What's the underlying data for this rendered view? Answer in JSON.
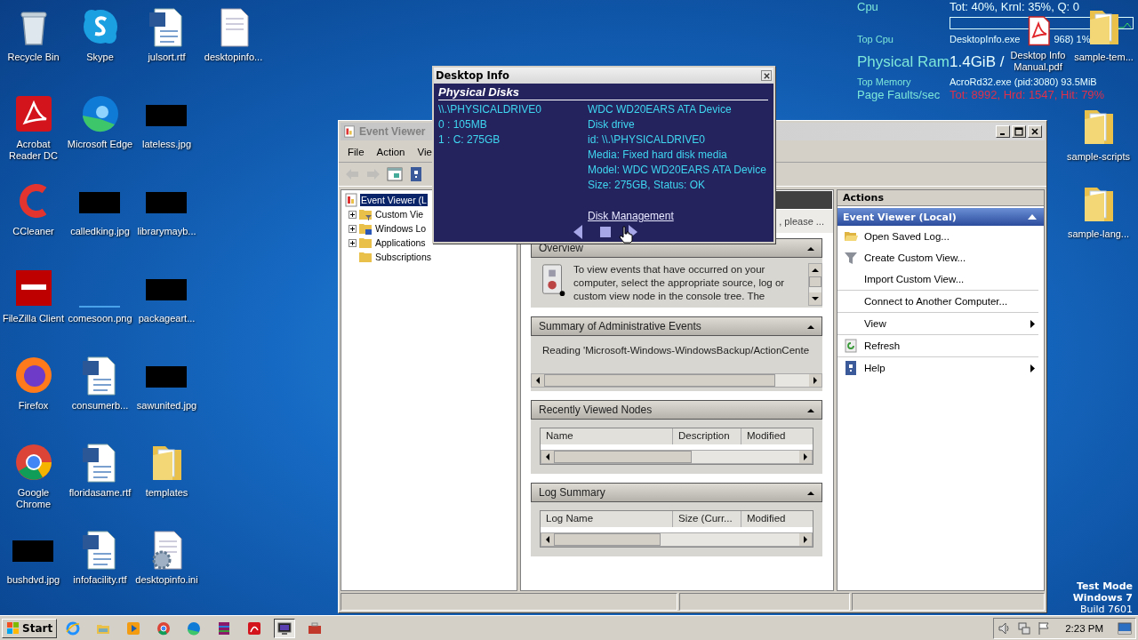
{
  "desktop_icons": [
    [
      {
        "label": "Recycle Bin",
        "kind": "recycle-bin"
      },
      {
        "label": "Skype",
        "kind": "skype"
      },
      {
        "label": "julsort.rtf",
        "kind": "document"
      },
      {
        "label": "desktopinfo...",
        "kind": "file"
      }
    ],
    [
      {
        "label": "Acrobat Reader DC",
        "kind": "acrobat"
      },
      {
        "label": "Microsoft Edge",
        "kind": "edge"
      },
      {
        "label": "lateless.jpg",
        "kind": "thumbnail"
      }
    ],
    [
      {
        "label": "CCleaner",
        "kind": "ccleaner"
      },
      {
        "label": "calledking.jpg",
        "kind": "thumbnail"
      },
      {
        "label": "librarymayb...",
        "kind": "thumbnail"
      }
    ],
    [
      {
        "label": "FileZilla Client",
        "kind": "filezilla"
      },
      {
        "label": "comesoon.png",
        "kind": "blank-image"
      },
      {
        "label": "packageart...",
        "kind": "thumbnail"
      }
    ],
    [
      {
        "label": "Firefox",
        "kind": "firefox"
      },
      {
        "label": "consumerb...",
        "kind": "document"
      },
      {
        "label": "sawunited.jpg",
        "kind": "thumbnail"
      }
    ],
    [
      {
        "label": "Google Chrome",
        "kind": "chrome"
      },
      {
        "label": "floridasame.rtf",
        "kind": "document"
      },
      {
        "label": "templates",
        "kind": "folder"
      }
    ],
    [
      {
        "label": "bushdvd.jpg",
        "kind": "thumbnail"
      },
      {
        "label": "infofacility.rtf",
        "kind": "document"
      },
      {
        "label": "desktopinfo.ini",
        "kind": "settings-file"
      }
    ]
  ],
  "desktop_icons_right": [
    {
      "label": "Desktop Info Manual.pdf",
      "kind": "pdf"
    },
    {
      "label": "sample-tem...",
      "kind": "folder"
    },
    {
      "label": "sample-scripts",
      "kind": "folder"
    },
    {
      "label": "sample-lang...",
      "kind": "folder"
    }
  ],
  "system_info": [
    {
      "label": "Cpu",
      "value": [
        "Tot: 40%, Krnl: 35%, Q: 0"
      ],
      "kind": "medium",
      "alert": false
    },
    {
      "label": "Top Cpu",
      "value": [
        "DesktopInfo.exe",
        "968) 1%"
      ],
      "kind": "small",
      "alert": false
    },
    {
      "label": "Physical Ram",
      "value": [
        "1.4GiB /"
      ],
      "kind": "large",
      "alert": false
    },
    {
      "label": "Top Memory",
      "value": [
        "AcroRd32.exe (pid:3080) 93.5MiB"
      ],
      "kind": "small",
      "alert": false
    },
    {
      "label": "Page Faults/sec",
      "value": [
        "Tot: 8992, Hrd: 1547, Hit: 79%"
      ],
      "kind": "medium",
      "alert": true
    }
  ],
  "event_viewer": {
    "title": "Event Viewer",
    "menu": [
      "File",
      "Action",
      "Vie"
    ],
    "toolbar": [
      {
        "kind": "back",
        "disabled": true
      },
      {
        "kind": "forward",
        "disabled": true
      },
      {
        "kind": "console",
        "disabled": false
      },
      {
        "kind": "help",
        "disabled": false
      }
    ],
    "tree": [
      {
        "label": "Event Viewer (L",
        "selected": true,
        "children": [
          {
            "label": "Custom Vie",
            "kind": "filter-folder",
            "selected": false,
            "expandable": true
          },
          {
            "label": "Windows Lo",
            "kind": "log-folder",
            "selected": false,
            "expandable": true
          },
          {
            "label": "Applications",
            "kind": "folder",
            "selected": false,
            "expandable": true
          },
          {
            "label": "Subscriptions",
            "kind": "folder",
            "selected": false,
            "expandable": false
          }
        ]
      }
    ],
    "notice": ", please ...",
    "sections": [
      {
        "title": "Overview",
        "kind": "overview",
        "text": "To view events that have occurred on your computer, select the appropriate source, log or custom view node in the console tree. The"
      },
      {
        "title": "Summary of Administrative Events",
        "kind": "summary",
        "text": "Reading 'Microsoft-Windows-WindowsBackup/ActionCente"
      },
      {
        "title": "Recently Viewed Nodes",
        "kind": "table",
        "columns": [
          "Name",
          "Description",
          "Modified"
        ]
      },
      {
        "title": "Log Summary",
        "kind": "table",
        "columns": [
          "Log Name",
          "Size (Curr...",
          "Modified"
        ]
      }
    ],
    "actions": {
      "title": "Actions",
      "group": "Event Viewer (Local)",
      "items": [
        {
          "label": "Open Saved Log...",
          "kind": "open",
          "submenu": false,
          "divider_after": false
        },
        {
          "label": "Create Custom View...",
          "kind": "filter",
          "submenu": false,
          "divider_after": false
        },
        {
          "label": "Import Custom View...",
          "kind": "none",
          "submenu": false,
          "divider_after": true
        },
        {
          "label": "Connect to Another Computer...",
          "kind": "none",
          "submenu": false,
          "divider_after": true
        },
        {
          "label": "View",
          "kind": "none",
          "submenu": true,
          "divider_after": true
        },
        {
          "label": "Refresh",
          "kind": "refresh",
          "submenu": false,
          "divider_after": true
        },
        {
          "label": "Help",
          "kind": "help",
          "submenu": true,
          "divider_after": false
        }
      ]
    }
  },
  "desktop_info_popup": {
    "title": "Desktop Info",
    "heading": "Physical Disks",
    "left": [
      "\\\\.\\PHYSICALDRIVE0",
      "0 : 105MB",
      "1 : C: 275GB"
    ],
    "right": [
      "WDC WD20EARS ATA Device",
      "Disk drive",
      "id: \\\\.\\PHYSICALDRIVE0",
      "Media: Fixed hard disk media",
      "Model: WDC WD20EARS ATA Device",
      "Size: 275GB, Status: OK"
    ],
    "link": "Disk Management"
  },
  "system_notice": [
    {
      "text": "Test Mode",
      "bold": true
    },
    {
      "text": "Windows 7",
      "bold": true
    },
    {
      "text": "Build 7601",
      "bold": false
    }
  ],
  "taskbar": {
    "start": "Start",
    "apps": [
      {
        "kind": "ie",
        "selected": false
      },
      {
        "kind": "explorer",
        "selected": false
      },
      {
        "kind": "media",
        "selected": false
      },
      {
        "kind": "chrome",
        "selected": false
      },
      {
        "kind": "edge",
        "selected": false
      },
      {
        "kind": "winrar",
        "selected": false
      },
      {
        "kind": "acrobat",
        "selected": false
      },
      {
        "kind": "monitor",
        "selected": true
      },
      {
        "kind": "toolbox",
        "selected": false
      }
    ],
    "clock": "2:23 PM"
  }
}
